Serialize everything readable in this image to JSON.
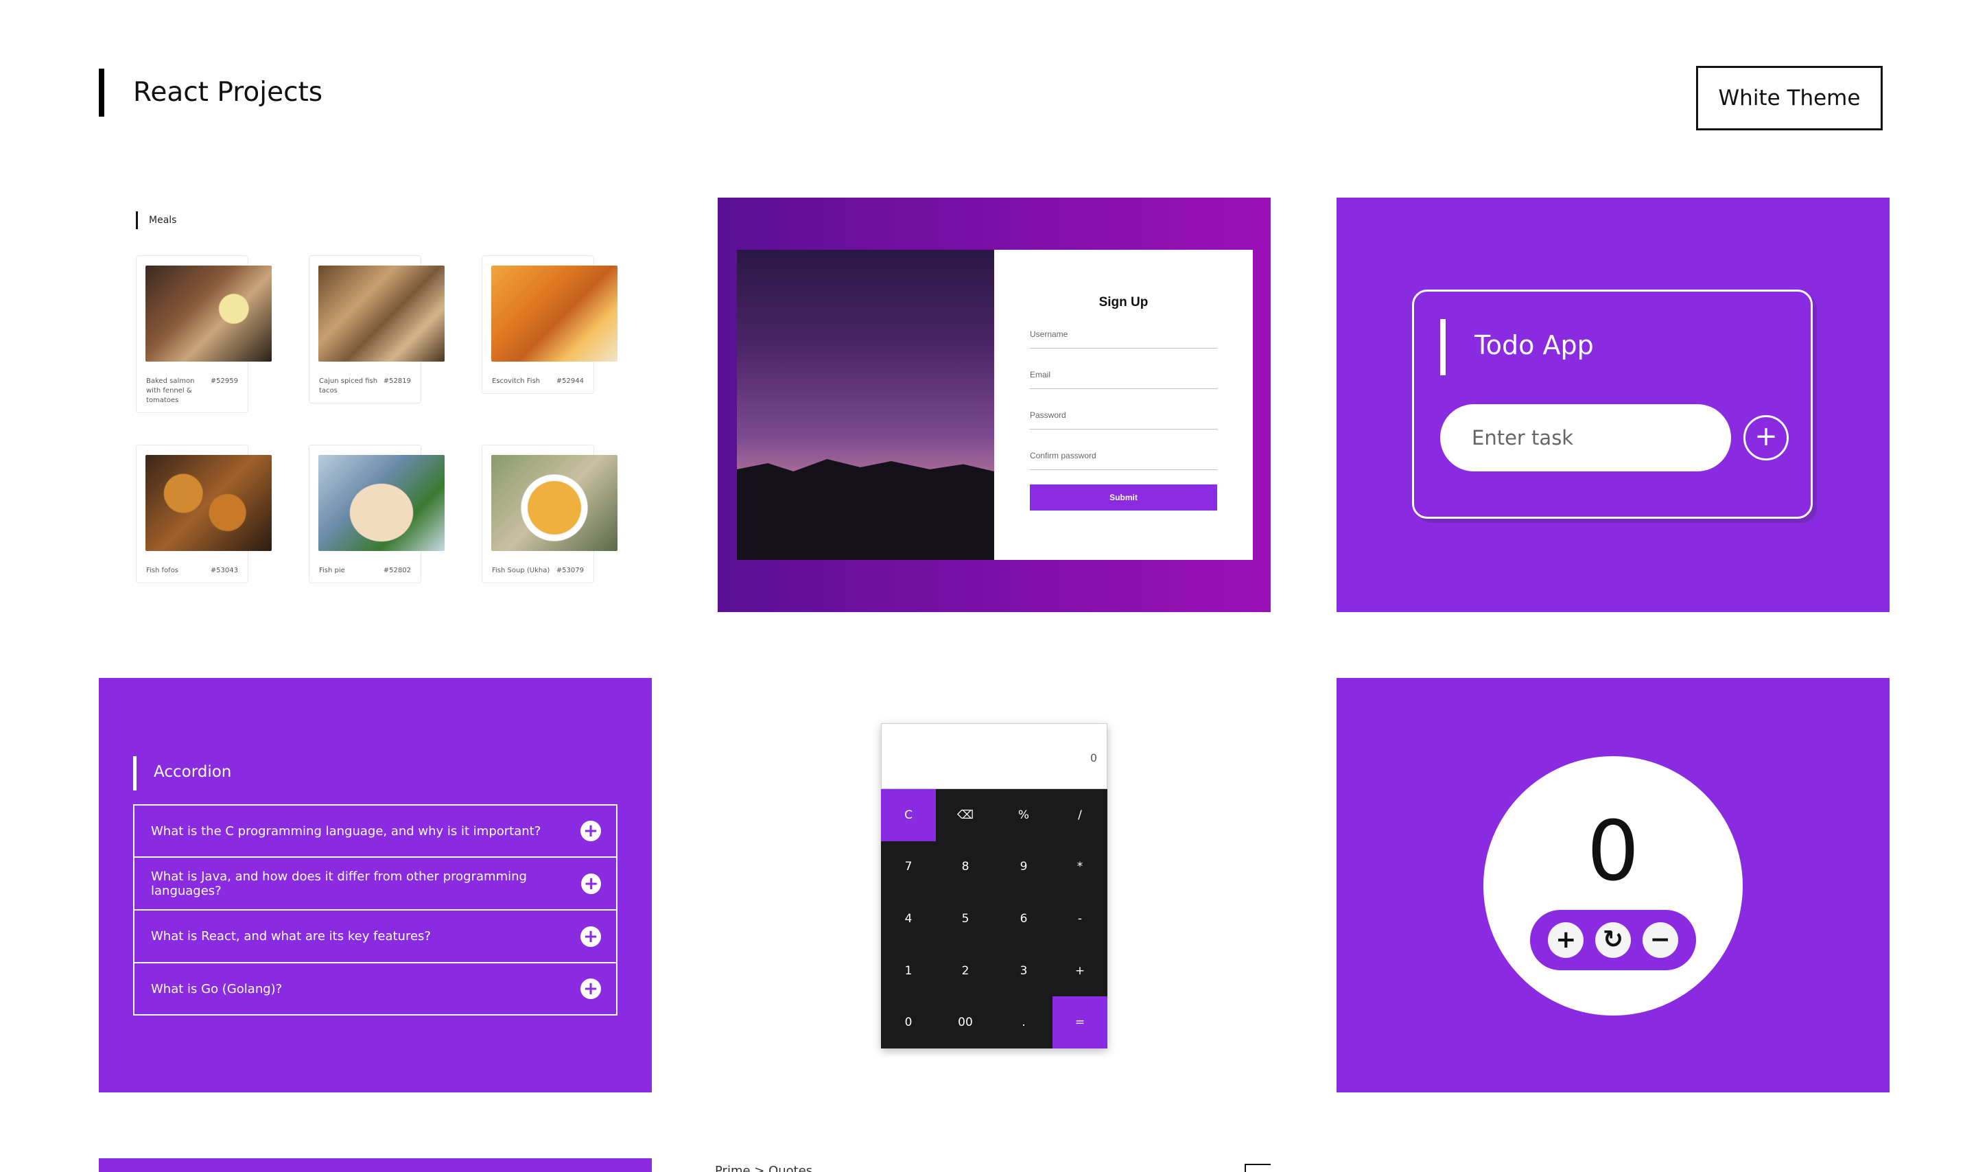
{
  "header": {
    "title": "React Projects",
    "theme_button": "White Theme"
  },
  "meals": {
    "title": "Meals",
    "items": [
      {
        "name": "Baked salmon with fennel & tomatoes",
        "id": "#52959"
      },
      {
        "name": "Cajun spiced fish tacos",
        "id": "#52819"
      },
      {
        "name": "Escovitch Fish",
        "id": "#52944"
      },
      {
        "name": "Fish fofos",
        "id": "#53043"
      },
      {
        "name": "Fish pie",
        "id": "#52802"
      },
      {
        "name": "Fish Soup (Ukha)",
        "id": "#53079"
      }
    ]
  },
  "signup": {
    "title": "Sign Up",
    "username": "Username",
    "email": "Email",
    "password": "Password",
    "confirm": "Confirm password",
    "submit": "Submit"
  },
  "todo": {
    "title": "Todo App",
    "placeholder": "Enter task",
    "add": "+"
  },
  "accordion": {
    "title": "Accordion",
    "items": [
      "What is the C programming language, and why is it important?",
      "What is Java, and how does it differ from other programming languages?",
      "What is React, and what are its key features?",
      "What is Go (Golang)?"
    ]
  },
  "calculator": {
    "display": "0",
    "keys": [
      "C",
      "⌫",
      "%",
      "/",
      "7",
      "8",
      "9",
      "*",
      "4",
      "5",
      "6",
      "-",
      "1",
      "2",
      "3",
      "+",
      "0",
      "00",
      ".",
      "="
    ]
  },
  "counter": {
    "value": "0",
    "plus": "+",
    "reset": "↻",
    "minus": "−"
  },
  "bottom": {
    "breadcrumb": "Prime > Quotes"
  },
  "colors": {
    "accent": "#8a2be2"
  }
}
